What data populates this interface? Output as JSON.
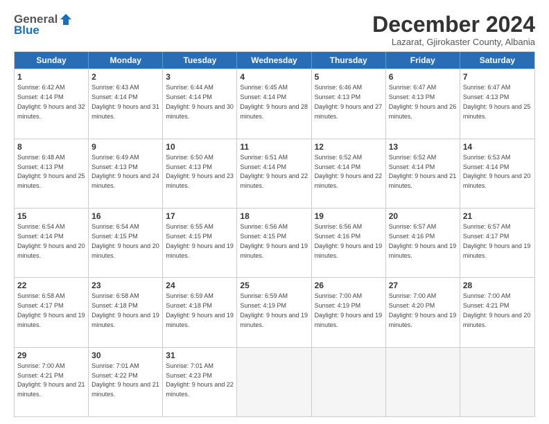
{
  "logo": {
    "line1": "General",
    "line2": "Blue"
  },
  "title": "December 2024",
  "subtitle": "Lazarat, Gjirokaster County, Albania",
  "headers": [
    "Sunday",
    "Monday",
    "Tuesday",
    "Wednesday",
    "Thursday",
    "Friday",
    "Saturday"
  ],
  "weeks": [
    [
      {
        "day": "1",
        "sunrise": "6:42 AM",
        "sunset": "4:14 PM",
        "daylight": "9 hours and 32 minutes."
      },
      {
        "day": "2",
        "sunrise": "6:43 AM",
        "sunset": "4:14 PM",
        "daylight": "9 hours and 31 minutes."
      },
      {
        "day": "3",
        "sunrise": "6:44 AM",
        "sunset": "4:14 PM",
        "daylight": "9 hours and 30 minutes."
      },
      {
        "day": "4",
        "sunrise": "6:45 AM",
        "sunset": "4:14 PM",
        "daylight": "9 hours and 28 minutes."
      },
      {
        "day": "5",
        "sunrise": "6:46 AM",
        "sunset": "4:13 PM",
        "daylight": "9 hours and 27 minutes."
      },
      {
        "day": "6",
        "sunrise": "6:47 AM",
        "sunset": "4:13 PM",
        "daylight": "9 hours and 26 minutes."
      },
      {
        "day": "7",
        "sunrise": "6:47 AM",
        "sunset": "4:13 PM",
        "daylight": "9 hours and 25 minutes."
      }
    ],
    [
      {
        "day": "8",
        "sunrise": "6:48 AM",
        "sunset": "4:13 PM",
        "daylight": "9 hours and 25 minutes."
      },
      {
        "day": "9",
        "sunrise": "6:49 AM",
        "sunset": "4:13 PM",
        "daylight": "9 hours and 24 minutes."
      },
      {
        "day": "10",
        "sunrise": "6:50 AM",
        "sunset": "4:13 PM",
        "daylight": "9 hours and 23 minutes."
      },
      {
        "day": "11",
        "sunrise": "6:51 AM",
        "sunset": "4:14 PM",
        "daylight": "9 hours and 22 minutes."
      },
      {
        "day": "12",
        "sunrise": "6:52 AM",
        "sunset": "4:14 PM",
        "daylight": "9 hours and 22 minutes."
      },
      {
        "day": "13",
        "sunrise": "6:52 AM",
        "sunset": "4:14 PM",
        "daylight": "9 hours and 21 minutes."
      },
      {
        "day": "14",
        "sunrise": "6:53 AM",
        "sunset": "4:14 PM",
        "daylight": "9 hours and 20 minutes."
      }
    ],
    [
      {
        "day": "15",
        "sunrise": "6:54 AM",
        "sunset": "4:14 PM",
        "daylight": "9 hours and 20 minutes."
      },
      {
        "day": "16",
        "sunrise": "6:54 AM",
        "sunset": "4:15 PM",
        "daylight": "9 hours and 20 minutes."
      },
      {
        "day": "17",
        "sunrise": "6:55 AM",
        "sunset": "4:15 PM",
        "daylight": "9 hours and 19 minutes."
      },
      {
        "day": "18",
        "sunrise": "6:56 AM",
        "sunset": "4:15 PM",
        "daylight": "9 hours and 19 minutes."
      },
      {
        "day": "19",
        "sunrise": "6:56 AM",
        "sunset": "4:16 PM",
        "daylight": "9 hours and 19 minutes."
      },
      {
        "day": "20",
        "sunrise": "6:57 AM",
        "sunset": "4:16 PM",
        "daylight": "9 hours and 19 minutes."
      },
      {
        "day": "21",
        "sunrise": "6:57 AM",
        "sunset": "4:17 PM",
        "daylight": "9 hours and 19 minutes."
      }
    ],
    [
      {
        "day": "22",
        "sunrise": "6:58 AM",
        "sunset": "4:17 PM",
        "daylight": "9 hours and 19 minutes."
      },
      {
        "day": "23",
        "sunrise": "6:58 AM",
        "sunset": "4:18 PM",
        "daylight": "9 hours and 19 minutes."
      },
      {
        "day": "24",
        "sunrise": "6:59 AM",
        "sunset": "4:18 PM",
        "daylight": "9 hours and 19 minutes."
      },
      {
        "day": "25",
        "sunrise": "6:59 AM",
        "sunset": "4:19 PM",
        "daylight": "9 hours and 19 minutes."
      },
      {
        "day": "26",
        "sunrise": "7:00 AM",
        "sunset": "4:19 PM",
        "daylight": "9 hours and 19 minutes."
      },
      {
        "day": "27",
        "sunrise": "7:00 AM",
        "sunset": "4:20 PM",
        "daylight": "9 hours and 19 minutes."
      },
      {
        "day": "28",
        "sunrise": "7:00 AM",
        "sunset": "4:21 PM",
        "daylight": "9 hours and 20 minutes."
      }
    ],
    [
      {
        "day": "29",
        "sunrise": "7:00 AM",
        "sunset": "4:21 PM",
        "daylight": "9 hours and 21 minutes."
      },
      {
        "day": "30",
        "sunrise": "7:01 AM",
        "sunset": "4:22 PM",
        "daylight": "9 hours and 21 minutes."
      },
      {
        "day": "31",
        "sunrise": "7:01 AM",
        "sunset": "4:23 PM",
        "daylight": "9 hours and 22 minutes."
      },
      null,
      null,
      null,
      null
    ]
  ]
}
